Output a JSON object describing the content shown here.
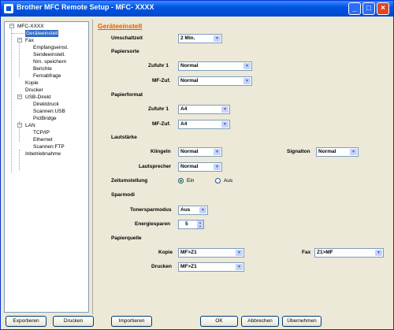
{
  "window": {
    "title": "Brother MFC Remote Setup - MFC- XXXX",
    "min_label": "_",
    "max_label": "□",
    "close_label": "×"
  },
  "tree": {
    "items": [
      {
        "label": "MFC-XXXX",
        "expander": "−"
      },
      {
        "label": "Geräteeinstell"
      },
      {
        "label": "Fax",
        "expander": "−"
      },
      {
        "label": "Empfangseinst."
      },
      {
        "label": "Sendeeinstell."
      },
      {
        "label": "Nrn. speichern"
      },
      {
        "label": "Berichte"
      },
      {
        "label": "Fernabfrage"
      },
      {
        "label": "Kopie"
      },
      {
        "label": "Drucker"
      },
      {
        "label": "USB-Direkt",
        "expander": "−"
      },
      {
        "label": "Direktdruck"
      },
      {
        "label": "Scannen:USB"
      },
      {
        "label": "PictBridge"
      },
      {
        "label": "LAN",
        "expander": "−"
      },
      {
        "label": "TCP/IP"
      },
      {
        "label": "Ethernet"
      },
      {
        "label": "Scannen:FTP"
      },
      {
        "label": "Inbetriebnahme"
      }
    ]
  },
  "panel": {
    "title": "Geräteeinstell",
    "umschaltzeit": {
      "label": "Umschaltzeit",
      "value": "2 Min."
    },
    "papiersorte": {
      "heading": "Papiersorte",
      "zufuhr1": {
        "label": "Zufuhr 1",
        "value": "Normal"
      },
      "mfzuf": {
        "label": "MF-Zuf.",
        "value": "Normal"
      }
    },
    "papierformat": {
      "heading": "Papierformat",
      "zufuhr1": {
        "label": "Zufuhr 1",
        "value": "A4"
      },
      "mfzuf": {
        "label": "MF-Zuf.",
        "value": "A4"
      }
    },
    "lautstaerke": {
      "heading": "Lautstärke",
      "klingeln": {
        "label": "Klingeln",
        "value": "Normal"
      },
      "signalton": {
        "label": "Signalton",
        "value": "Normal"
      },
      "lautsprecher": {
        "label": "Lautsprecher",
        "value": "Normal"
      }
    },
    "zeitumstellung": {
      "label": "Zeitumstellung",
      "on_label": "Ein",
      "off_label": "Aus",
      "selected": "Ein"
    },
    "sparmodi": {
      "heading": "Sparmodi",
      "toner": {
        "label": "Tonersparmodus",
        "value": "Aus"
      },
      "energie": {
        "label": "Energiesparen",
        "value": "5"
      }
    },
    "papierquelle": {
      "heading": "Papierquelle",
      "kopie": {
        "label": "Kopie",
        "value": "MF>Z1"
      },
      "fax": {
        "label": "Fax",
        "value": "Z1>MF"
      },
      "drucken": {
        "label": "Drucken",
        "value": "MF>Z1"
      }
    }
  },
  "buttons": {
    "exportieren": "Exportieren",
    "drucken": "Drucken",
    "importieren": "Importieren",
    "ok": "OK",
    "abbrechen": "Abbrechen",
    "uebernehmen": "Übernehmen"
  },
  "icons": {
    "dropdown": "▼",
    "spin_up": "▲",
    "spin_down": "▼"
  },
  "colors": {
    "title_bar": "#0054e3",
    "accent_title": "#e35a00",
    "selection": "#316ac5"
  }
}
